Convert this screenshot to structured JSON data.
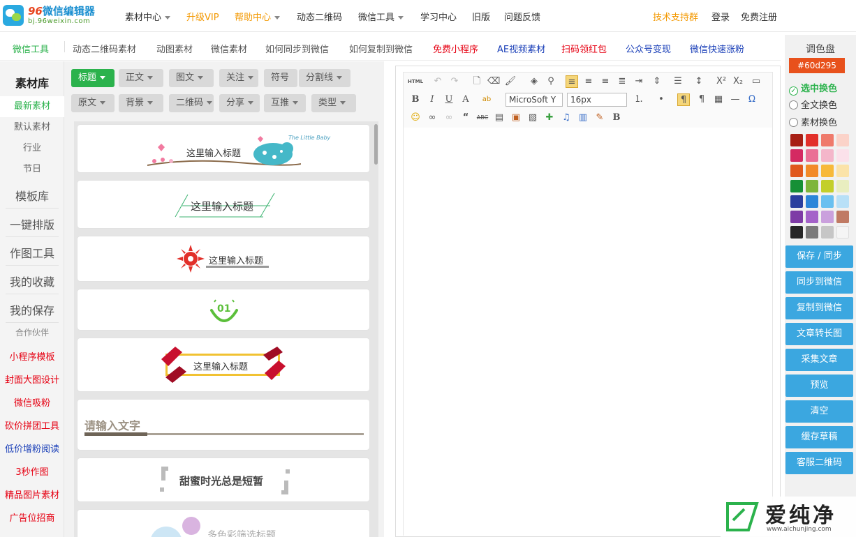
{
  "logo": {
    "name_num": "96",
    "name_text": "微信编辑器",
    "domain": "bj.96weixin.com"
  },
  "topnav": {
    "items": [
      {
        "label": "素材中心",
        "has_caret": true,
        "color": "#333333"
      },
      {
        "label": "升级VIP",
        "has_caret": false,
        "color": "#f39800"
      },
      {
        "label": "帮助中心",
        "has_caret": true,
        "color": "#f39800"
      },
      {
        "label": "动态二维码",
        "has_caret": false,
        "color": "#333333"
      },
      {
        "label": "微信工具",
        "has_caret": true,
        "color": "#333333"
      },
      {
        "label": "学习中心",
        "has_caret": false,
        "color": "#333333"
      },
      {
        "label": "旧版",
        "has_caret": false,
        "color": "#333333"
      },
      {
        "label": "问题反馈",
        "has_caret": false,
        "color": "#333333"
      }
    ],
    "support": "技术支持群",
    "login": "登录",
    "register": "免费注册"
  },
  "subnav": {
    "items": [
      {
        "label": "微信工具",
        "color": "#2bb24c"
      },
      {
        "label": "动态二维码素材",
        "color": "#555555"
      },
      {
        "label": "动图素材",
        "color": "#555555"
      },
      {
        "label": "微信素材",
        "color": "#555555"
      },
      {
        "label": "如何同步到微信",
        "color": "#555555"
      },
      {
        "label": "如何复制到微信",
        "color": "#555555"
      },
      {
        "label": "免费小程序",
        "color": "#e60012"
      },
      {
        "label": "AE视频素材",
        "color": "#1a3fb8"
      },
      {
        "label": "扫码领红包",
        "color": "#e60012"
      },
      {
        "label": "公众号变现",
        "color": "#1a3fb8"
      },
      {
        "label": "微信快速涨粉",
        "color": "#1a3fb8"
      }
    ]
  },
  "sidebar": {
    "title": "素材库",
    "items": [
      {
        "label": "最新素材",
        "color": "#2bb24c"
      },
      {
        "label": "默认素材",
        "color": "#666666"
      },
      {
        "label": "行业",
        "color": "#666666"
      },
      {
        "label": "节日",
        "color": "#666666"
      }
    ],
    "sections": [
      "模板库",
      "一键排版",
      "作图工具",
      "我的收藏",
      "我的保存"
    ],
    "partner_label": "合作伙伴",
    "partners": [
      {
        "label": "小程序模板",
        "color": "#e60012"
      },
      {
        "label": "封面大图设计",
        "color": "#e60012"
      },
      {
        "label": "微信吸粉",
        "color": "#e60012"
      },
      {
        "label": "砍价拼团工具",
        "color": "#e60012"
      },
      {
        "label": "低价增粉阅读",
        "color": "#1a3fb8"
      },
      {
        "label": "3秒作图",
        "color": "#e60012"
      },
      {
        "label": "精品图片素材",
        "color": "#e60012"
      },
      {
        "label": "广告位招商",
        "color": "#e60012"
      }
    ]
  },
  "categories": {
    "row1": [
      "标题",
      "正文",
      "图文",
      "关注",
      "符号",
      "分割线"
    ],
    "row2": [
      "原文",
      "背景",
      "二维码",
      "分享",
      "互推",
      "类型"
    ]
  },
  "cards": {
    "c1": "这里输入标题",
    "c1_deco": "The Little Baby",
    "c2": "这里输入标题",
    "c3": "这里输入标题",
    "c4": "01",
    "c5": "这里输入标题",
    "c6": "请输入文字",
    "c7": "甜蜜时光总是短暂",
    "c8": "多色彩筛选标题"
  },
  "editor": {
    "html_label": "HTML",
    "font_family": "MicroSoft Y",
    "font_size": "16px"
  },
  "palette": {
    "title": "调色盘",
    "current_color": "#60d295",
    "options": [
      {
        "label": "选中换色",
        "selected": true
      },
      {
        "label": "全文换色",
        "selected": false
      },
      {
        "label": "素材换色",
        "selected": false
      }
    ],
    "swatches": [
      "#a71f14",
      "#e2302a",
      "#ef7a6b",
      "#fbd3c9",
      "#d42a62",
      "#ea6f95",
      "#f4b6ca",
      "#fbe1ea",
      "#e0581c",
      "#f28a28",
      "#f7b93a",
      "#fbe3a9",
      "#169036",
      "#7eb53a",
      "#c3cf2b",
      "#e9eec0",
      "#2a3f9e",
      "#2b86d9",
      "#69c0f0",
      "#b8e0f7",
      "#7e3ba6",
      "#a462c9",
      "#caa0dd",
      "#c07a64",
      "#262626",
      "#7b7b7b",
      "#c6c6c6",
      "#f5f5f5"
    ]
  },
  "actions": [
    "保存 / 同步",
    "同步到微信",
    "复制到微信",
    "文章转长图",
    "采集文章",
    "预览",
    "清空",
    "缓存草稿",
    "客服二维码"
  ],
  "watermark": {
    "text": "爱纯净",
    "url": "www.aichunjing.com"
  }
}
